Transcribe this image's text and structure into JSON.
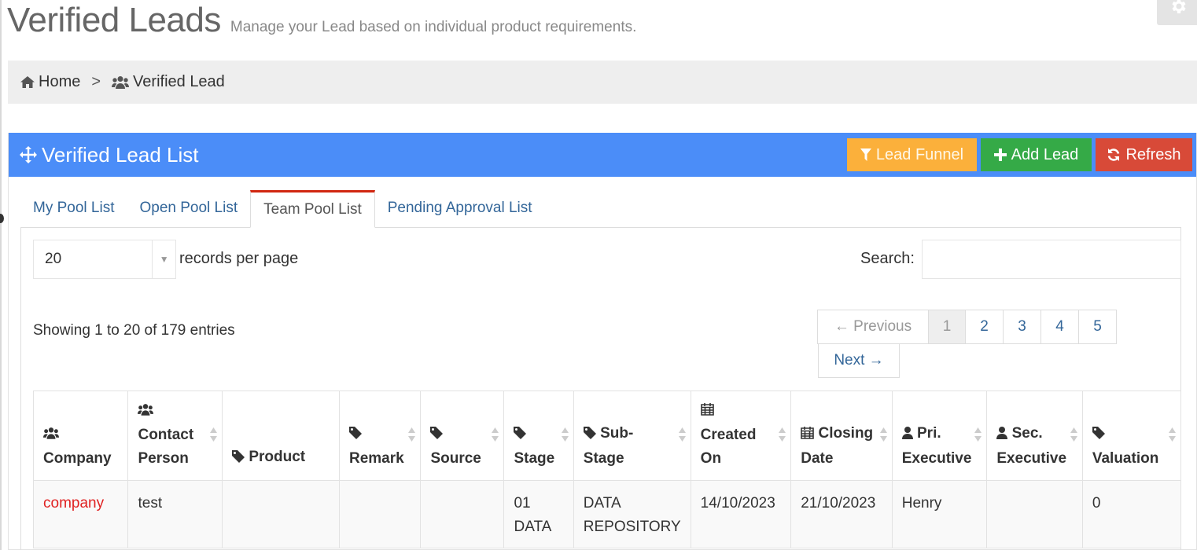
{
  "header": {
    "title": "Verified Leads",
    "subtitle": "Manage your Lead based on individual product requirements."
  },
  "breadcrumb": {
    "home": "Home",
    "separator": ">",
    "current": "Verified Lead"
  },
  "portlet": {
    "title": "Verified Lead List",
    "actions": {
      "lead_funnel": "Lead Funnel",
      "add_lead": "Add Lead",
      "refresh": "Refresh"
    },
    "colors": {
      "head": "#4b8df8",
      "funnel": "#fbb03b",
      "add": "#35aa47",
      "refresh": "#d84a38",
      "active_tab": "#d12610"
    }
  },
  "tabs": [
    {
      "label": "My Pool List",
      "active": false
    },
    {
      "label": "Open Pool List",
      "active": false
    },
    {
      "label": "Team Pool List",
      "active": true
    },
    {
      "label": "Pending Approval List",
      "active": false
    }
  ],
  "table_controls": {
    "page_length": "20",
    "page_length_label": "records per page",
    "search_label": "Search:",
    "search_value": "",
    "info": "Showing 1 to 20 of 179 entries"
  },
  "pagination": {
    "previous": "← Previous",
    "pages": [
      "1",
      "2",
      "3",
      "4",
      "5"
    ],
    "current": "1",
    "next": "Next →"
  },
  "columns": [
    {
      "l1": "",
      "l2": "Company",
      "icon": "users-icon"
    },
    {
      "l1": "Contact",
      "l2": "Person",
      "icon": "users-icon"
    },
    {
      "l1": "",
      "l2": "Product",
      "icon": "tag-icon"
    },
    {
      "l1": "",
      "l2": "Remark",
      "icon": "tag-icon"
    },
    {
      "l1": "",
      "l2": "Source",
      "icon": "tag-icon"
    },
    {
      "l1": "",
      "l2": "Stage",
      "icon": "tag-icon"
    },
    {
      "l1": "Sub-",
      "l2": "Stage",
      "icon": "tag-icon"
    },
    {
      "l1": "Created",
      "l2": "On",
      "icon": "calendar-icon"
    },
    {
      "l1": "Closing",
      "l2": "Date",
      "icon": "calendar-icon"
    },
    {
      "l1": "Pri.",
      "l2": "Executive",
      "icon": "user-icon"
    },
    {
      "l1": "Sec.",
      "l2": "Executive",
      "icon": "user-icon"
    },
    {
      "l1": "",
      "l2": "Valuation",
      "icon": "tag-icon"
    }
  ],
  "rows": [
    {
      "company": "company",
      "contact": "test",
      "product": "",
      "remark": "",
      "source": "",
      "stage_1": "01",
      "stage_2": "DATA",
      "substage_1": "DATA",
      "substage_2": "REPOSITORY",
      "created": "14/10/2023",
      "closing": "21/10/2023",
      "pri_exec": "Henry",
      "sec_exec": "",
      "valuation": "0"
    }
  ]
}
